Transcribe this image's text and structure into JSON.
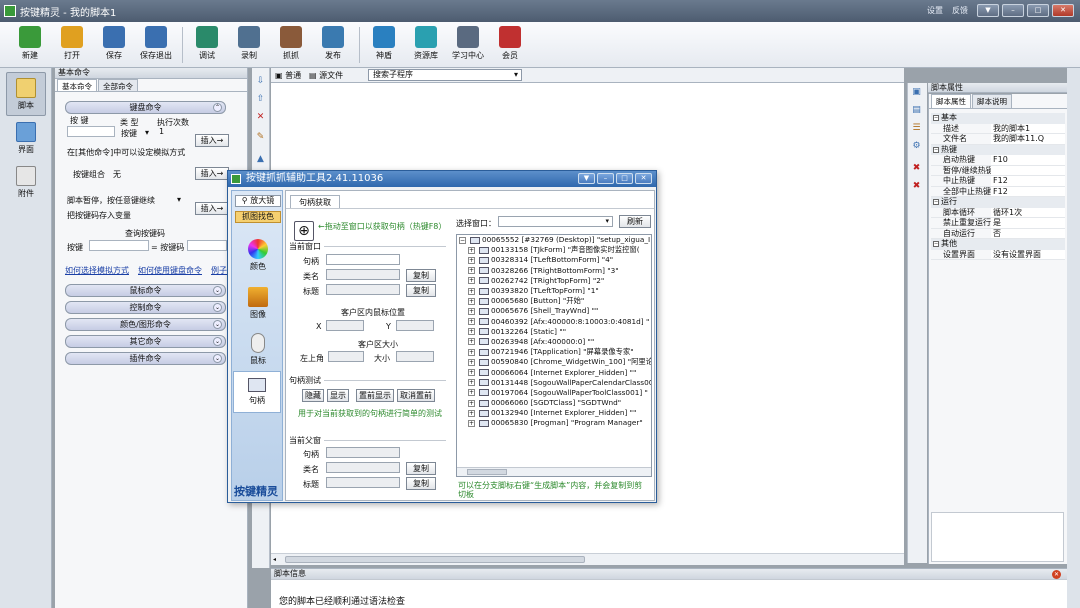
{
  "window": {
    "title": "按键精灵 - 我的脚本1",
    "links": [
      "设置",
      "反馈"
    ]
  },
  "toolbar": [
    {
      "label": "新建",
      "color": "#3a9a3a"
    },
    {
      "label": "打开",
      "color": "#e0a020"
    },
    {
      "label": "保存",
      "color": "#3a6fb0"
    },
    {
      "label": "保存退出",
      "color": "#3a6fb0"
    },
    {
      "label": "调试",
      "color": "#2a8a6a"
    },
    {
      "label": "录制",
      "color": "#507090"
    },
    {
      "label": "抓抓",
      "color": "#8a5a3a"
    },
    {
      "label": "发布",
      "color": "#3a7ab0"
    },
    {
      "label": "神盾",
      "color": "#2a80c0"
    },
    {
      "label": "资源库",
      "color": "#2aa0b0"
    },
    {
      "label": "学习中心",
      "color": "#5a6a80"
    },
    {
      "label": "会员",
      "color": "#c03030"
    }
  ],
  "leftstrip": [
    {
      "label": "脚本"
    },
    {
      "label": "界面"
    },
    {
      "label": "附件"
    }
  ],
  "cmd": {
    "title": "基本命令",
    "tabs": [
      "基本命令",
      "全部命令"
    ],
    "keyboard_group": "键盘命令",
    "key_label": "按 键",
    "type_label": "类 型",
    "times_label": "执行次数",
    "times_value": "1",
    "key_type": "按键",
    "insert": "插入→",
    "hint": "在[其他命令]中可以设定模拟方式",
    "combo_label": "按键组合",
    "combo_value": "无",
    "pause_label": "脚本暂停，按任意键继续",
    "store_label": "把按键码存入变量",
    "query_label": "查询按键码",
    "query_key": "按键",
    "query_code": "= 按键码",
    "link1": "如何选择模拟方式",
    "link2": "如何使用键盘命令",
    "link3": "例子",
    "groups": [
      "鼠标命令",
      "控制命令",
      "颜色/图形命令",
      "其它命令",
      "插件命令"
    ]
  },
  "editor": {
    "tabs": [
      "普通",
      "源文件"
    ],
    "search": "搜索子程序",
    "info_title": "脚本信息",
    "info_text": "您的脚本已经顺利通过语法检查"
  },
  "props": {
    "title": "脚本属性",
    "tabs": [
      "脚本属性",
      "脚本说明"
    ],
    "cats": [
      {
        "name": "基本",
        "rows": [
          [
            "描述",
            "我的脚本1"
          ],
          [
            "文件名",
            "我的脚本11.Q"
          ]
        ]
      },
      {
        "name": "热键",
        "rows": [
          [
            "启动热键",
            "F10"
          ],
          [
            "暂停/继续热键",
            ""
          ],
          [
            "中止热键",
            "F12"
          ],
          [
            "全部中止热键",
            "F12"
          ]
        ]
      },
      {
        "name": "运行",
        "rows": [
          [
            "脚本循环",
            "循环1次"
          ],
          [
            "禁止重复运行",
            "是"
          ],
          [
            "自动运行",
            "否"
          ]
        ]
      },
      {
        "name": "其他",
        "rows": [
          [
            "设置界面",
            "没有设置界面"
          ]
        ]
      }
    ]
  },
  "dialog": {
    "title": "按键抓抓辅助工具2.41.11036",
    "side": [
      "放大镜",
      "抓图找色",
      "颜色",
      "图像",
      "鼠标",
      "句柄"
    ],
    "brand": "按键精灵",
    "tab": "句柄获取",
    "drag_hint": "←拖动至窗口以获取句柄（热键F8）",
    "cur_win": "当前窗口",
    "handle": "句柄",
    "class": "类名",
    "caption": "标题",
    "copy": "复制",
    "mouse_pos": "客户区内鼠标位置",
    "x": "X",
    "y": "Y",
    "client_size": "客户区大小",
    "top_left": "左上角",
    "size": "大小",
    "test": "句柄测试",
    "btns": [
      "隐藏",
      "显示",
      "置前显示",
      "取消置前"
    ],
    "test_hint": "用于对当前获取到的句柄进行简单的测试",
    "parent": "当前父窗",
    "select_win": "选择窗口：",
    "refresh": "刷新",
    "footer": "可以在分支脚标右键“生成脚本”内容，并会复制到剪切板",
    "tree_root": "00065552 [#32769 (Desktop)] \"setup_xigua_I",
    "tree": [
      "00133158 [TJkForm] \"声音图像实时监控窗(",
      "00328314 [TLeftBottomForm] \"4\"",
      "00328266 [TRightBottomForm] \"3\"",
      "00262742 [TRightTopForm] \"2\"",
      "00393820 [TLeftTopForm] \"1\"",
      "00065680 [Button] \"开始\"",
      "00065676 [Shell_TrayWnd] \"\"",
      "00460392 [Afx:400000:8:10003:0:4081d] \"",
      "00132264 [Static] \"\"",
      "00263948 [Afx:400000:0] \"\"",
      "00721946 [TApplication] \"屏幕录像专家\"",
      "00590840 [Chrome_WidgetWin_100] \"阿里论",
      "00066064 [Internet Explorer_Hidden] \"\"",
      "00131448 [SogouWallPaperCalendarClass00",
      "00197064 [SogouWallPaperToolClass001] \"",
      "00066060 [SGDTClass] \"SGDTWnd\"",
      "00132940 [Internet Explorer_Hidden] \"\"",
      "00065830 [Progman] \"Program Manager\""
    ]
  }
}
